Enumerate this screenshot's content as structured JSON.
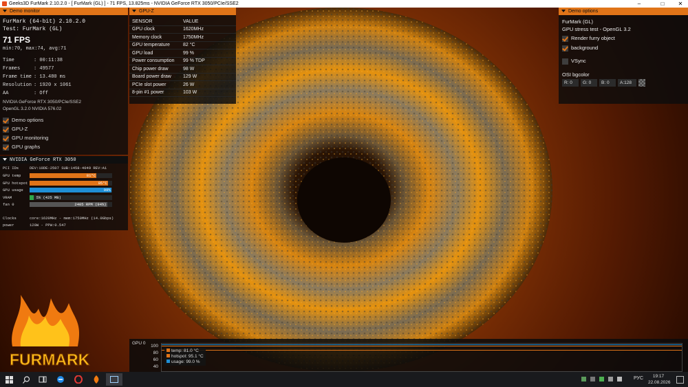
{
  "window": {
    "title": "Geeks3D FurMark 2.10.2.0 - [ FurMark (GL) ] - 71 FPS, 13.825ms - NVIDIA GeForce RTX 3050/PCIe/SSE2"
  },
  "demo_monitor": {
    "header": "Demo monitor",
    "app_name": "FurMark (64-bit) 2.10.2.0",
    "test_name": "Test: FurMark (GL)",
    "fps": "71 FPS",
    "fps_stats": "min:70, max:74, avg:71",
    "stats": [
      {
        "label": "Time",
        "value": ": 00:11:38"
      },
      {
        "label": "Frames",
        "value": ": 49577"
      },
      {
        "label": "Frame time",
        "value": ": 13.480 ms"
      },
      {
        "label": "Resolution",
        "value": ": 1920 x 1061"
      },
      {
        "label": "AA",
        "value": ": Off"
      }
    ],
    "renderer": "NVIDIA GeForce RTX 3050/PCIe/SSE2",
    "opengl": "OpenGL 3.2.0 NVIDIA 576.02",
    "checkboxes": [
      {
        "label": "Demo options",
        "checked": true
      },
      {
        "label": "GPU-Z",
        "checked": true
      },
      {
        "label": "GPU monitoring",
        "checked": true
      },
      {
        "label": "GPU graphs",
        "checked": true
      }
    ]
  },
  "gpu_monitor": {
    "header": "NVIDIA GeForce RTX 3050",
    "pci_label": "PCI IDs",
    "pci_value": "DEV:10DE-2507 SUB:1458-4049 REV:A1",
    "rows": [
      {
        "label": "GPU temp",
        "text": "81°C",
        "level": 0.81,
        "color": "#e07418"
      },
      {
        "label": "GPU hotspot",
        "text": "95°C",
        "level": 0.95,
        "color": "#e07418"
      },
      {
        "label": "GPU usage",
        "text": "99%",
        "level": 0.99,
        "color": "#1f8fd6"
      },
      {
        "label": "VRAM",
        "text": "5% (425 MB)",
        "level": 0.05,
        "color": "#2fa84a"
      },
      {
        "label": "fan 0",
        "text": "2405 RPM (94%)",
        "level": 0.94,
        "color": "#555555"
      }
    ],
    "clocks_label": "Clocks",
    "clocks_value": "core:1620MHz - mem:1750MHz (14.0Gbps)",
    "power_label": "power",
    "power_value": "120W - PPW:0.547"
  },
  "gpuz": {
    "header": "GPU-Z",
    "col_sensor": "SENSOR",
    "col_value": "VALUE",
    "rows": [
      {
        "sensor": "GPU clock",
        "value": "1620MHz"
      },
      {
        "sensor": "Memory clock",
        "value": "1750MHz"
      },
      {
        "sensor": "GPU temperature",
        "value": "82 °C"
      },
      {
        "sensor": "GPU load",
        "value": "99 %"
      },
      {
        "sensor": "Power consumption",
        "value": "99 % TDP"
      },
      {
        "sensor": "Chip power draw",
        "value": "98 W"
      },
      {
        "sensor": "Board power draw",
        "value": "129 W"
      },
      {
        "sensor": "PCIe slot power",
        "value": "26 W"
      },
      {
        "sensor": "8-pin #1 power",
        "value": "103 W"
      }
    ]
  },
  "demo_options": {
    "header": "Demo options",
    "title": "FurMark (GL)",
    "subtitle": "GPU stress test - OpenGL 3.2",
    "render_furry": {
      "label": "Render furry object",
      "checked": true
    },
    "background": {
      "label": "background",
      "checked": true
    },
    "vsync": {
      "label": "VSync",
      "checked": false
    },
    "osi_label": "OSI bgcolor",
    "rgba": {
      "r": "R: 0",
      "g": "G: 0",
      "b": "B: 0",
      "a": "A:128"
    }
  },
  "graph": {
    "label": "GPU 0",
    "yticks": [
      "100",
      "80",
      "60",
      "40"
    ],
    "legend": [
      {
        "text": "temp: 81.0 °C",
        "color": "#e07418"
      },
      {
        "text": "hotspot: 95.1 °C",
        "color": "#e07418"
      },
      {
        "text": "usage: 99.0 %",
        "color": "#1f8fd6"
      }
    ]
  },
  "logo": {
    "text": "FURMARK"
  },
  "taskbar": {
    "lang": "РУС",
    "time": "19:17",
    "date": "22.08.2026"
  },
  "colors": {
    "accent": "#e07418",
    "panel": "#0c0c0c"
  }
}
